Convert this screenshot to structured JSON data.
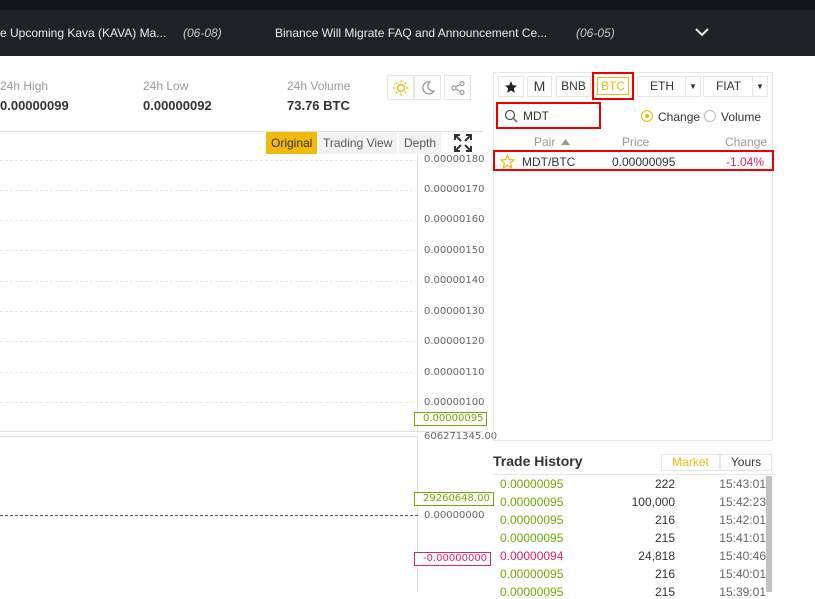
{
  "news": {
    "item1_title": "e Upcoming Kava (KAVA) Ma...",
    "item1_date": "(06-08)",
    "item2_title": "Binance Will Migrate FAQ and Announcement Ce...",
    "item2_date": "(06-05)"
  },
  "stats": {
    "high_label": "24h High",
    "high_value": "0.00000099",
    "low_label": "24h Low",
    "low_value": "0.00000092",
    "volume_label": "24h Volume",
    "volume_value": "73.76 BTC"
  },
  "chart_tabs": [
    "Original",
    "Trading View",
    "Depth"
  ],
  "y_ticks": [
    "0.00000180",
    "0.00000170",
    "0.00000160",
    "0.00000150",
    "0.00000140",
    "0.00000130",
    "0.00000120",
    "0.00000110",
    "0.00000100"
  ],
  "price_tag": "0.00000095",
  "vol_top": "606271345.00",
  "vol_tag": "29260648.00",
  "vol_zero": "0.00000000",
  "neg_tag": "-0.00000000",
  "market": {
    "tabs": [
      "M",
      "BNB",
      "BTC",
      "ETH",
      "FIAT"
    ],
    "search_value": "MDT",
    "sort_change": "Change",
    "sort_volume": "Volume",
    "col_pair": "Pair",
    "col_price": "Price",
    "col_change": "Change",
    "row_pair": "MDT/BTC",
    "row_price": "0.00000095",
    "row_change": "-1.04%"
  },
  "trade_history": {
    "title": "Trade History",
    "tab_market": "Market",
    "tab_yours": "Yours",
    "rows": [
      {
        "price": "0.00000095",
        "amount": "222",
        "time": "15:43:01",
        "side": "buy"
      },
      {
        "price": "0.00000095",
        "amount": "100,000",
        "time": "15:42:23",
        "side": "buy"
      },
      {
        "price": "0.00000095",
        "amount": "216",
        "time": "15:42:01",
        "side": "buy"
      },
      {
        "price": "0.00000095",
        "amount": "215",
        "time": "15:41:01",
        "side": "buy"
      },
      {
        "price": "0.00000094",
        "amount": "24,818",
        "time": "15:40:46",
        "side": "sell"
      },
      {
        "price": "0.00000095",
        "amount": "216",
        "time": "15:40:01",
        "side": "buy"
      },
      {
        "price": "0.00000095",
        "amount": "215",
        "time": "15:39:01",
        "side": "buy"
      }
    ]
  },
  "colors": {
    "accent": "#f0b90b",
    "buy": "#70a800",
    "sell": "#e0245e",
    "highlight": "#e00000"
  }
}
